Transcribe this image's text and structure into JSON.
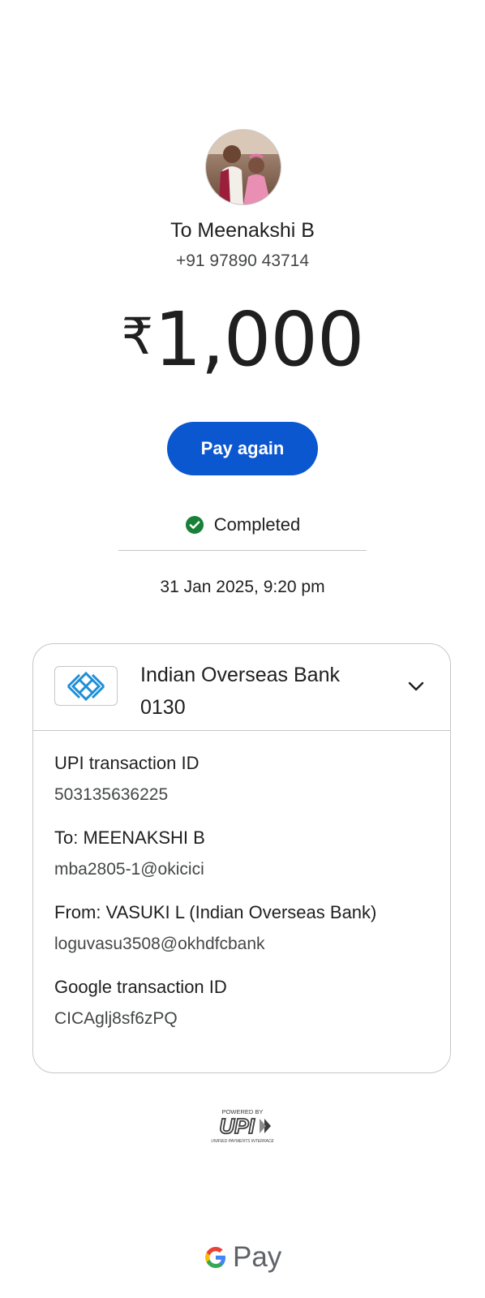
{
  "recipient": {
    "title": "To Meenakshi B",
    "phone": "+91 97890 43714"
  },
  "amount": {
    "currency_symbol": "₹",
    "value": "1,000"
  },
  "actions": {
    "pay_again_label": "Pay again"
  },
  "status": {
    "text": "Completed",
    "icon": "check-circle-icon",
    "color": "#188038"
  },
  "datetime": "31 Jan 2025, 9:20 pm",
  "bank": {
    "name": "Indian Overseas Bank",
    "account_suffix": "0130",
    "logo_icon": "iob-logo-icon",
    "logo_color": "#1d8fd8"
  },
  "details": [
    {
      "label": "UPI transaction ID",
      "value": "503135636225"
    },
    {
      "label": "To: MEENAKSHI  B",
      "value": "mba2805-1@okicici"
    },
    {
      "label": "From: VASUKI L (Indian Overseas Bank)",
      "value": "loguvasu3508@okhdfcbank"
    },
    {
      "label": "Google transaction ID",
      "value": "CICAglj8sf6zPQ"
    }
  ],
  "footer": {
    "upi_logo": {
      "powered_by": "POWERED BY",
      "brand": "UPI",
      "tagline": "UNIFIED PAYMENTS INTERFACE"
    },
    "gpay_logo": {
      "g": "G",
      "text": "Pay"
    }
  },
  "colors": {
    "primary_button": "#0b57d0",
    "text_primary": "#1f1f1f",
    "text_secondary": "#444746",
    "divider": "#c4c7c5"
  }
}
